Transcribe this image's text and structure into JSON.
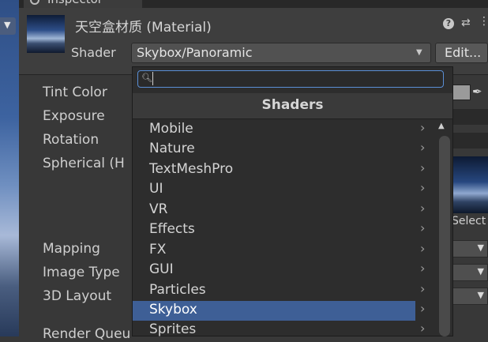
{
  "tab": {
    "label": "Inspector"
  },
  "material": {
    "title": "天空盒材质 (Material)",
    "shader_label": "Shader",
    "shader_value": "Skybox/Panoramic",
    "edit_label": "Edit..."
  },
  "properties": [
    "Tint Color",
    "Exposure",
    "Rotation",
    "Spherical  (H",
    "Mapping",
    "Image Type",
    "3D Layout",
    "Render Queu"
  ],
  "texture_select_label": "Select",
  "popup": {
    "search_value": "",
    "header": "Shaders",
    "items": [
      {
        "label": "Mobile",
        "selected": false
      },
      {
        "label": "Nature",
        "selected": false
      },
      {
        "label": "TextMeshPro",
        "selected": false
      },
      {
        "label": "UI",
        "selected": false
      },
      {
        "label": "VR",
        "selected": false
      },
      {
        "label": "Effects",
        "selected": false
      },
      {
        "label": "FX",
        "selected": false
      },
      {
        "label": "GUI",
        "selected": false
      },
      {
        "label": "Particles",
        "selected": false
      },
      {
        "label": "Skybox",
        "selected": true
      },
      {
        "label": "Sprites",
        "selected": false
      }
    ]
  },
  "colors": {
    "selection": "#3e5f96",
    "search_focus": "#5a8fd6",
    "panel": "#383838",
    "popup": "#2d2d2d"
  }
}
